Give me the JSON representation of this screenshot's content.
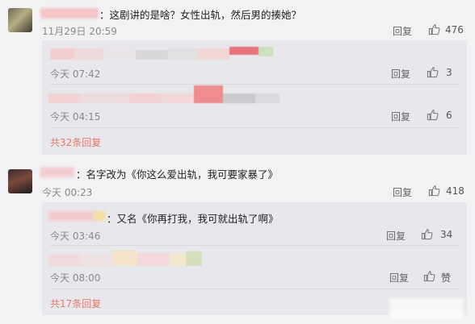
{
  "comment1": {
    "text": "：这剧讲的是啥？女性出轨，然后男的揍她？",
    "time": "11月29日 20:59",
    "reply_label": "回复",
    "likes": "476",
    "replies": [
      {
        "time": "今天 07:42",
        "reply_label": "回复",
        "likes": "3"
      },
      {
        "time": "今天 04:15",
        "reply_label": "回复",
        "likes": "6"
      }
    ],
    "more": "共32条回复"
  },
  "comment2": {
    "text": "：名字改为《你这么爱出轨，我可要家暴了》",
    "time": "今天 00:23",
    "reply_label": "回复",
    "likes": "418",
    "replies": [
      {
        "text": "：又名《你再打我，我可就出轨了啊》",
        "time": "今天 03:46",
        "reply_label": "回复",
        "likes": "34"
      },
      {
        "time": "今天 08:00",
        "reply_label": "回复",
        "likes": "赞"
      }
    ],
    "more": "共17条回复"
  },
  "colors": {
    "accent": "#e8786b",
    "background": "#f2f1f4",
    "reply_box": "#e8e7eb"
  },
  "icons": [
    "thumb-up-icon"
  ]
}
